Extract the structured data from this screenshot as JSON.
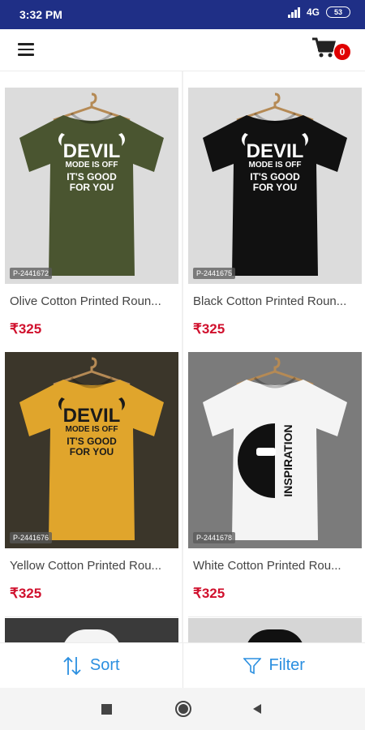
{
  "status": {
    "time": "3:32 PM",
    "network": "4G",
    "battery": "53"
  },
  "header": {
    "cart_count": "0"
  },
  "products": [
    {
      "name": "Olive Cotton Printed Roun...",
      "price": "₹325",
      "code": "P-2441672",
      "shirt_color": "#4a5530",
      "bg": "#dcdcdc",
      "print_color": "#ffffff",
      "print_top": "DEVIL",
      "print_mid": "MODE IS OFF",
      "print_bottom": "IT'S GOOD FOR YOU"
    },
    {
      "name": "Black Cotton Printed Roun...",
      "price": "₹325",
      "code": "P-2441675",
      "shirt_color": "#111111",
      "bg": "#dcdcdc",
      "print_color": "#ffffff",
      "print_top": "DEVIL",
      "print_mid": "MODE IS OFF",
      "print_bottom": "IT'S GOOD FOR YOU"
    },
    {
      "name": "Yellow Cotton Printed Rou...",
      "price": "₹325",
      "code": "P-2441676",
      "shirt_color": "#e0a52c",
      "bg": "#3b362a",
      "print_color": "#1a1a1a",
      "print_top": "DEVIL",
      "print_mid": "MODE IS OFF",
      "print_bottom": "IT'S GOOD FOR YOU"
    },
    {
      "name": "White Cotton Printed Rou...",
      "price": "₹325",
      "code": "P-2441678",
      "shirt_color": "#f4f4f4",
      "bg": "#7b7b7b",
      "print_color": "#111111",
      "print_top": "INSPIRATION",
      "print_mid": "",
      "print_bottom": ""
    }
  ],
  "bottom": {
    "sort_label": "Sort",
    "filter_label": "Filter"
  },
  "colors": {
    "accent": "#2b8fe0",
    "price": "#d0102d",
    "statusbar": "#1f2f86",
    "badge": "#e00000"
  }
}
